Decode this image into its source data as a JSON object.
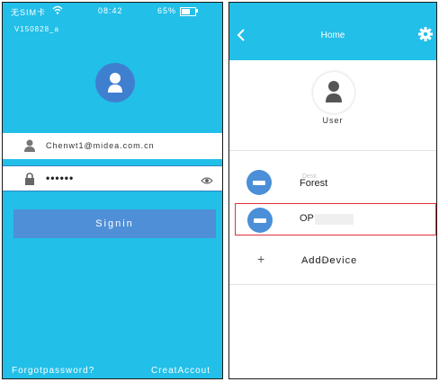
{
  "status_bar": {
    "carrier": "无SIM卡",
    "time": "08:42",
    "battery_percent": "65%",
    "battery_level": 0.65
  },
  "login": {
    "version": "V150828_a",
    "email": "Chenwt1@midea.com.cn",
    "password": "••••••",
    "signin_label": "Signin",
    "forgot_label": "Forgotpassword?",
    "create_label": "CreatAccout",
    "colors": {
      "background": "#22bfe8",
      "button": "#4f8fd7",
      "avatar": "#3f7fd0"
    }
  },
  "home": {
    "title": "Home",
    "user_label": "User",
    "devices": [
      {
        "name": "Forest",
        "ghost": "Desk",
        "icon": "air-conditioner-icon",
        "selected": false
      },
      {
        "name": "OP",
        "icon": "air-conditioner-icon",
        "selected": true
      }
    ],
    "add_device_label": "AddDevice",
    "add_device_ghost": "Add Device",
    "colors": {
      "header": "#22bfe8",
      "device_icon": "#4a8fd8",
      "selection_border": "#e0303a"
    }
  },
  "icons": [
    "wifi-icon",
    "battery-icon",
    "user-avatar-icon",
    "person-icon",
    "lock-icon",
    "eye-icon",
    "back-chevron-icon",
    "gear-icon",
    "air-conditioner-icon",
    "plus-icon"
  ]
}
